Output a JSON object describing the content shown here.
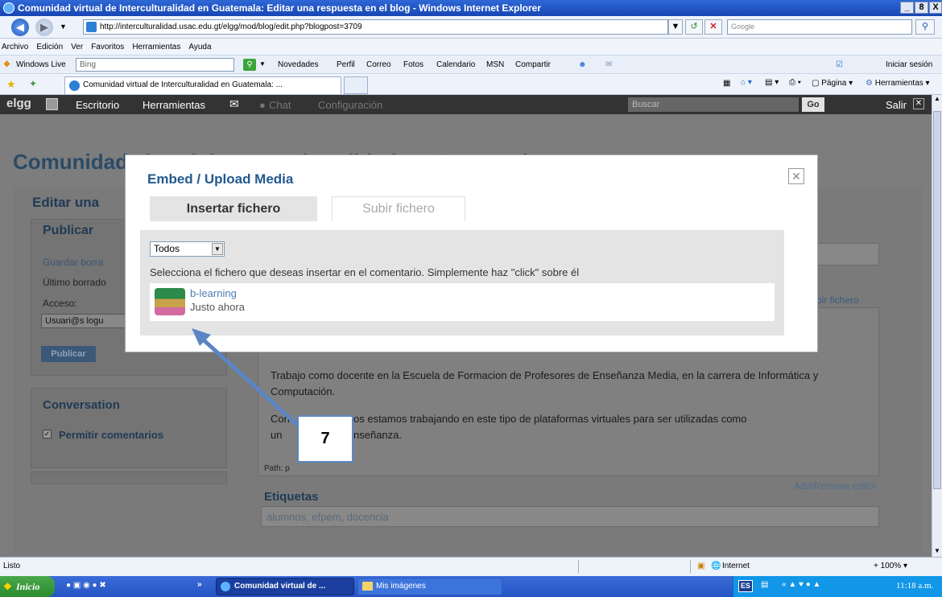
{
  "window": {
    "title": "Comunidad virtual de Interculturalidad en Guatemala: Editar una respuesta en el blog - Windows Internet Explorer",
    "controls": [
      "_",
      "8",
      "X"
    ]
  },
  "addressbar": {
    "url": "http://interculturalidad.usac.edu.gt/elgg/mod/blog/edit.php?blogpost=3709",
    "search_placeholder": "Google"
  },
  "menubar": [
    "Archivo",
    "Edición",
    "Ver",
    "Favoritos",
    "Herramientas",
    "Ayuda"
  ],
  "wlbar": {
    "brand": "Windows Live",
    "search_value": "Bing",
    "items": [
      "Novedades",
      "Perfil",
      "Correo",
      "Fotos",
      "Calendario",
      "MSN",
      "Compartir"
    ],
    "signin": "Iniciar sesión"
  },
  "favbar": {
    "tab_title": "Comunidad virtual de Interculturalidad en Guatemala: ...",
    "tools": [
      "Página",
      "Herramientas"
    ]
  },
  "elgg": {
    "logo": "elgg",
    "nav": [
      "Escritorio",
      "Herramientas",
      "Chat",
      "Configuración"
    ],
    "search_placeholder": "Buscar",
    "go": "Go",
    "logout": "Salir"
  },
  "page": {
    "site_title": "Comunidad virtual de Interculturalidad en Guatemala",
    "edit_heading": "Editar una",
    "publish": {
      "title": "Publicar",
      "save_draft": "Guardar borra",
      "last_draft": "Último borrado",
      "access_label": "Acceso:",
      "access_value": "Usuari@s logu",
      "publish_button": "Publicar"
    },
    "conversation": {
      "title": "Conversation",
      "allow_comments": "Permitir comentarios"
    },
    "upload_link": "bir fichero",
    "body_text_1": "Trabajo como docente en la Escuela de Formacion de Profesores de Enseñanza Media, en la carrera de Informática y Computación.",
    "body_text_2_a": "Con",
    "body_text_2_b": "os estamos trabajando en este tipo de plataformas virtuales para ser utilizadas como",
    "body_text_3_a": "un",
    "body_text_3_b": "nseñanza.",
    "path": "Path: p",
    "editor_toggle": "Add/Remove editor",
    "tags_title": "Etiquetas",
    "tags_value": "alumnos, efpem, docencia"
  },
  "modal": {
    "title": "Embed / Upload Media",
    "tab_insert": "Insertar fichero",
    "tab_upload": "Subir fichero",
    "filter_value": "Todos",
    "instruction": "Selecciona el fichero que deseas insertar en el comentario. Simplemente haz \"click\" sobre él",
    "file_name": "b-learning",
    "file_time": "Justo ahora"
  },
  "annotation": {
    "step_number": "7",
    "arrow_color": "#5b86c4"
  },
  "statusbar": {
    "status": "Listo",
    "zone": "Internet",
    "zoom": "100%"
  },
  "taskbar": {
    "start": "Inicio",
    "tasks": [
      "Comunidad virtual de ...",
      "Mis imágenes"
    ],
    "lang": "ES",
    "clock": "11:18 a.m."
  }
}
